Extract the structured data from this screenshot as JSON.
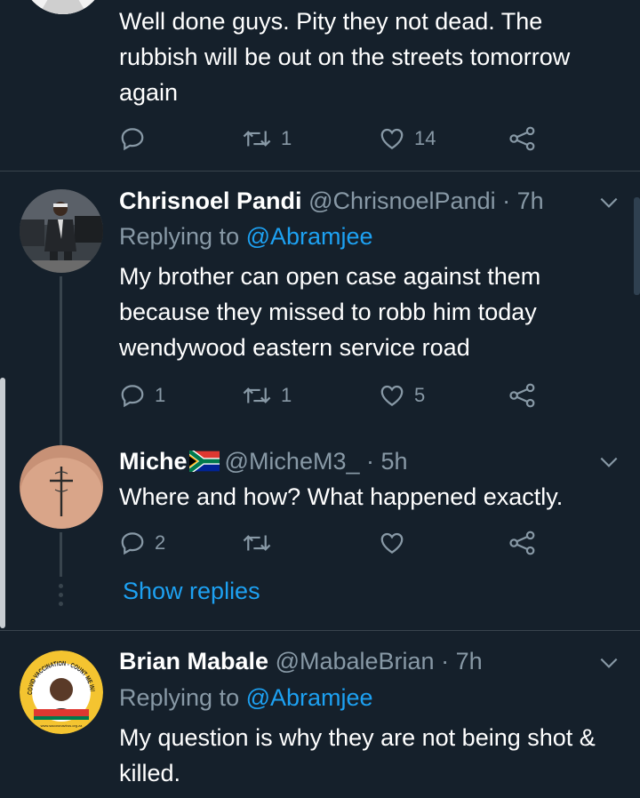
{
  "tweets": [
    {
      "body": "Well done guys. Pity they not dead. The rubbish will be out on the streets tomorrow again",
      "reply_count": "",
      "retweet_count": "1",
      "like_count": "14"
    },
    {
      "name": "Chrisnoel Pandi",
      "handle": "@ChrisnoelPandi",
      "time": "· 7h",
      "replying_prefix": "Replying to",
      "replying_to": "@Abramjee",
      "body": "My brother can open case against them because they missed to robb him today wendywood eastern service road",
      "reply_count": "1",
      "retweet_count": "1",
      "like_count": "5"
    },
    {
      "name": "Miche",
      "handle": "@MicheM3_",
      "time": "· 5h",
      "body": "Where and how? What happened exactly.",
      "reply_count": "2",
      "retweet_count": "",
      "like_count": "",
      "show_replies": "Show replies"
    },
    {
      "name": "Brian Mabale",
      "handle": "@MabaleBrian",
      "time": "· 7h",
      "replying_prefix": "Replying to",
      "replying_to": "@Abramjee",
      "body": "My question is why they are not being shot & killed.",
      "avatar_ring_text": "COVID VACCINATION - COUNT ME IN!",
      "avatar_footer_text": "www.sacoronavirus.org.za"
    }
  ],
  "colors": {
    "background": "#15202b",
    "divider": "#38444d",
    "muted": "#8899a6",
    "accent": "#1da1f2",
    "text": "#ffffff"
  },
  "icons": [
    "reply-icon",
    "retweet-icon",
    "like-icon",
    "share-icon",
    "chevron-down-icon",
    "south-africa-flag-icon"
  ]
}
